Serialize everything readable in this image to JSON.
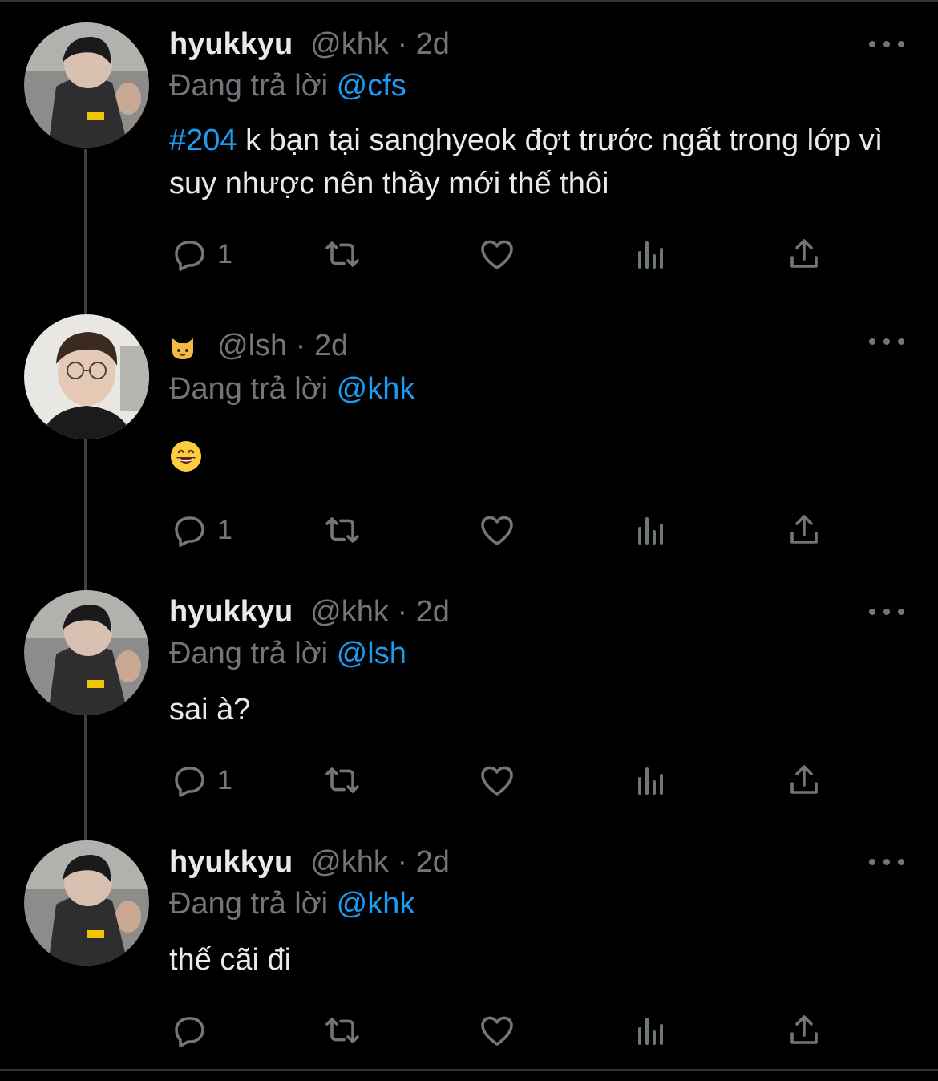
{
  "reply_prefix": "Đang trả lời",
  "tweets": [
    {
      "name": "hyukkyu",
      "handle": "@khk",
      "time": "2d",
      "sep": "·",
      "reply_to": "@cfs",
      "hashtag": "#204",
      "text": "k bạn tại sanghyeok đợt trước ngất trong lớp vì suy nhược nên thầy mới thế thôi",
      "reply_count": "1",
      "avatar_icon": "avatar-hyukkyu"
    },
    {
      "name": "",
      "name_icon": "cat-emoji-icon",
      "handle": "@lsh",
      "time": "2d",
      "sep": "·",
      "reply_to": "@khk",
      "text": "",
      "content_icon": "grinning-face-emoji",
      "reply_count": "1",
      "avatar_icon": "avatar-lsh"
    },
    {
      "name": "hyukkyu",
      "handle": "@khk",
      "time": "2d",
      "sep": "·",
      "reply_to": "@lsh",
      "text": "sai à?",
      "reply_count": "1",
      "avatar_icon": "avatar-hyukkyu"
    },
    {
      "name": "hyukkyu",
      "handle": "@khk",
      "time": "2d",
      "sep": "·",
      "reply_to": "@khk",
      "text": "thế cãi đi",
      "reply_count": "",
      "avatar_icon": "avatar-hyukkyu"
    }
  ],
  "colors": {
    "background": "#000000",
    "text": "#e7e9ea",
    "muted": "#71767b",
    "accent": "#1d9bf0"
  }
}
